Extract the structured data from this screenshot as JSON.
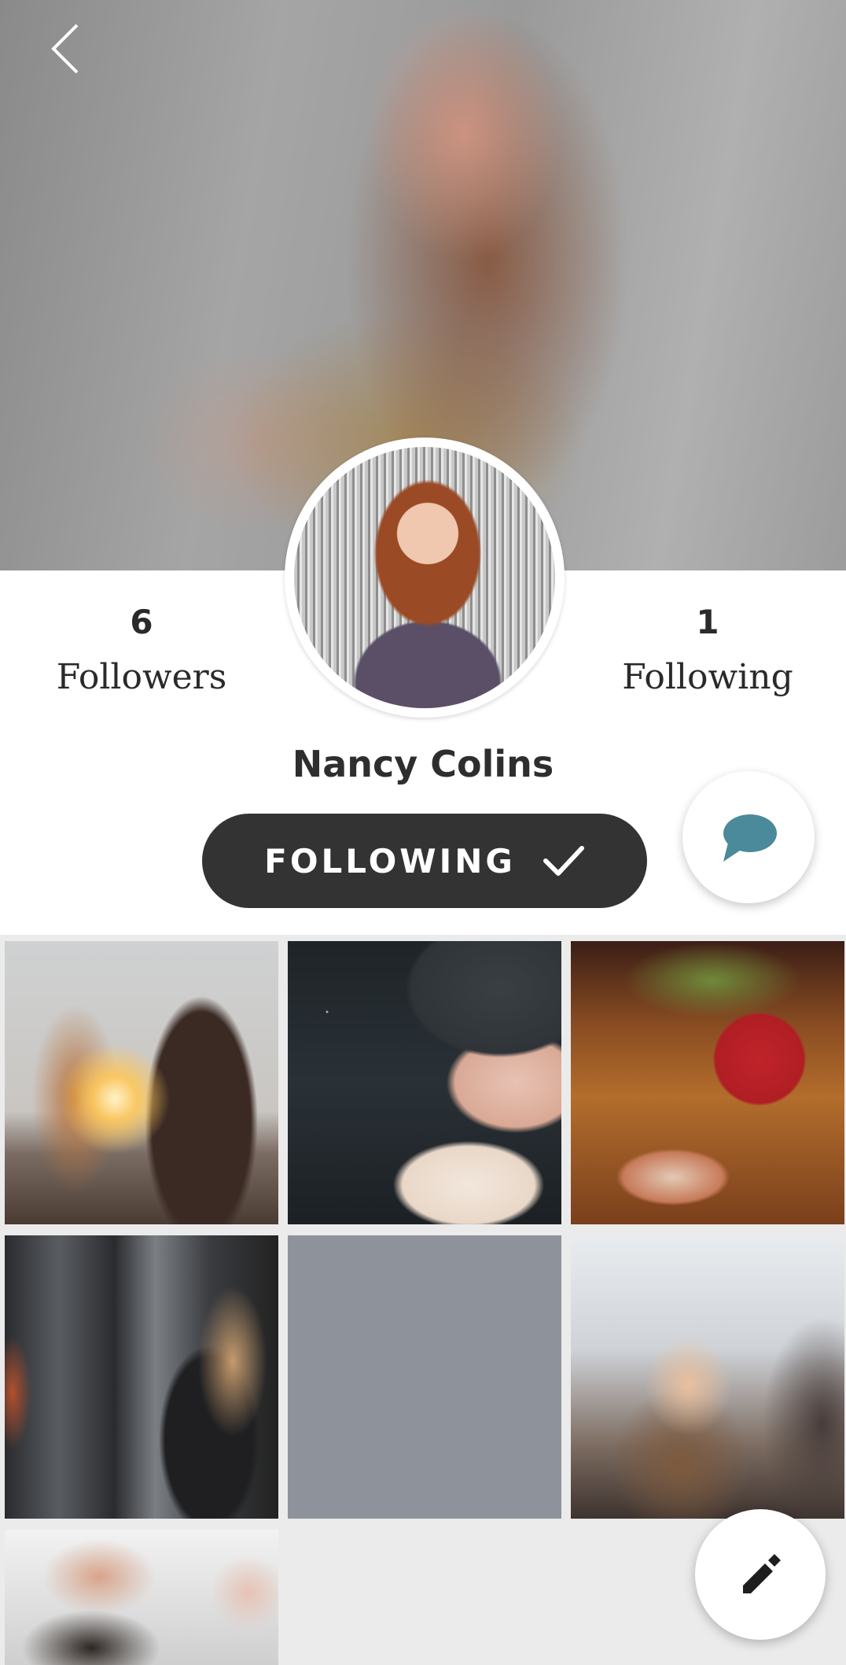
{
  "profile": {
    "name": "Nancy Colins",
    "followers_count": "6",
    "followers_label": "Followers",
    "following_count": "1",
    "following_label": "Following"
  },
  "actions": {
    "follow_label": "FOLLOWING",
    "follow_icon": "checkmark-icon",
    "chat_icon": "chat-bubble-icon",
    "edit_icon": "pencil-icon",
    "back_icon": "chevron-left-icon"
  },
  "colors": {
    "button_bg": "#333333",
    "chat_icon": "#4a8a9a",
    "grid_bg": "#ebebeb"
  },
  "gallery": {
    "tiles": [
      "couple-sunset",
      "winter-hat-snow",
      "christmas-mug-cookies",
      "gym-workout",
      "placeholder",
      "friends-laughing",
      "couple-christmas"
    ]
  }
}
